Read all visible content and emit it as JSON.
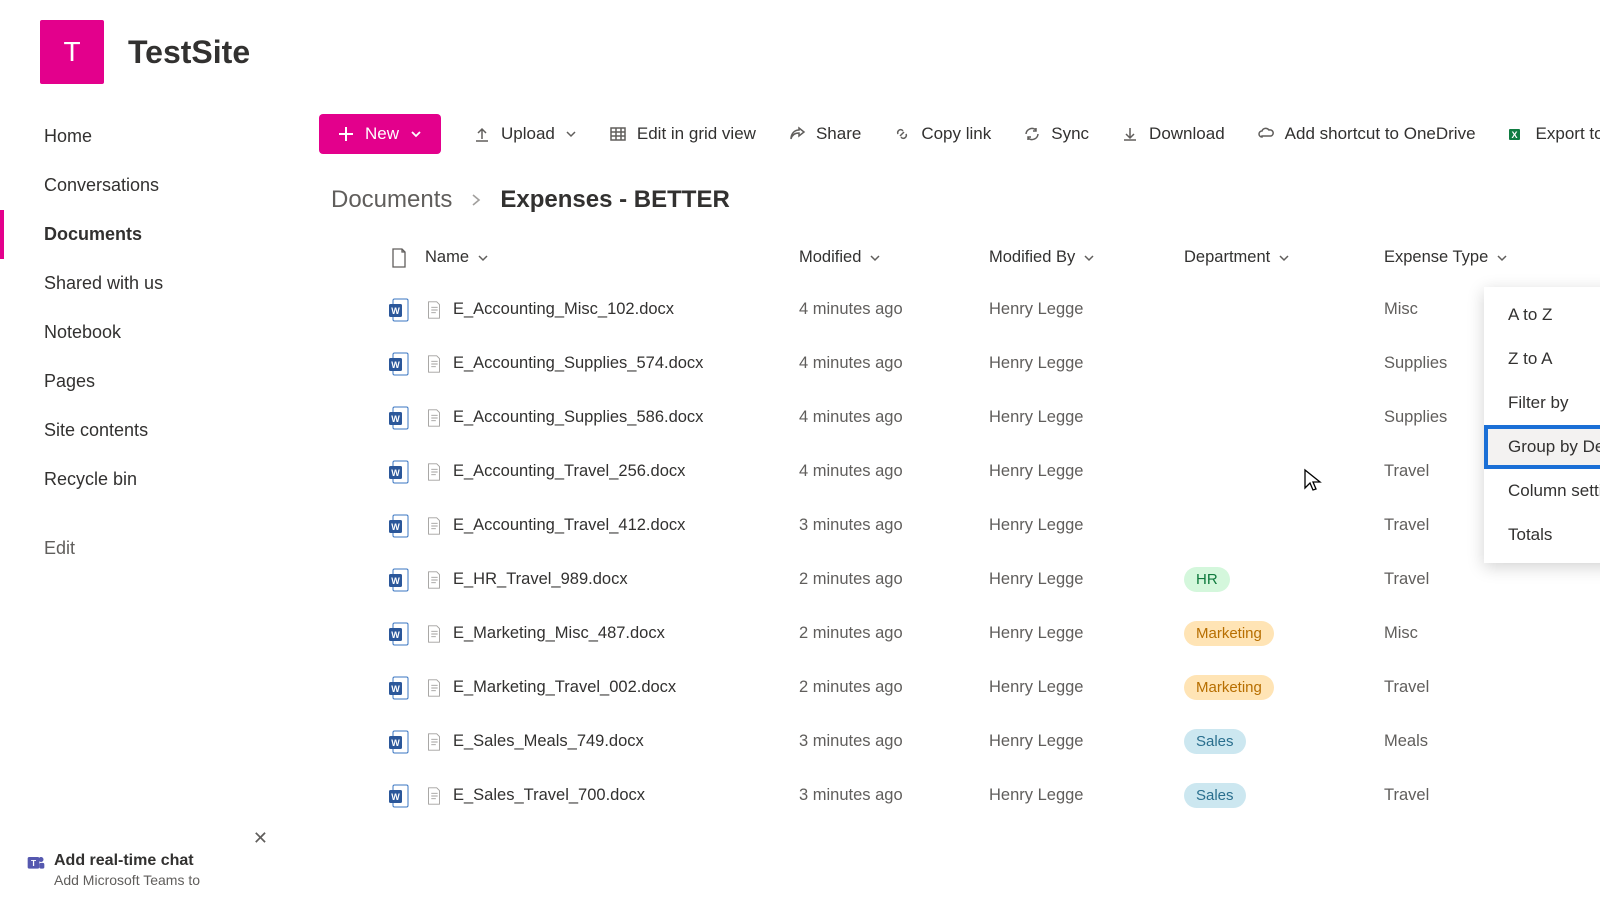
{
  "site": {
    "logo_letter": "T",
    "title": "TestSite"
  },
  "nav": {
    "items": [
      {
        "label": "Home",
        "active": false
      },
      {
        "label": "Conversations",
        "active": false
      },
      {
        "label": "Documents",
        "active": true
      },
      {
        "label": "Shared with us",
        "active": false
      },
      {
        "label": "Notebook",
        "active": false
      },
      {
        "label": "Pages",
        "active": false
      },
      {
        "label": "Site contents",
        "active": false
      },
      {
        "label": "Recycle bin",
        "active": false
      }
    ],
    "edit": "Edit"
  },
  "chat_promo": {
    "title": "Add real-time chat",
    "subtitle": "Add Microsoft Teams to"
  },
  "toolbar": {
    "new": "New",
    "upload": "Upload",
    "grid": "Edit in grid view",
    "share": "Share",
    "copy": "Copy link",
    "sync": "Sync",
    "download": "Download",
    "shortcut": "Add shortcut to OneDrive",
    "export": "Export to Ex"
  },
  "breadcrumb": {
    "root": "Documents",
    "current": "Expenses - BETTER"
  },
  "columns": {
    "name": "Name",
    "modified": "Modified",
    "modified_by": "Modified By",
    "department": "Department",
    "expense_type": "Expense Type"
  },
  "rows": [
    {
      "name": "E_Accounting_Misc_102.docx",
      "modified": "4 minutes ago",
      "by": "Henry Legge",
      "dept": "",
      "exp": "Misc"
    },
    {
      "name": "E_Accounting_Supplies_574.docx",
      "modified": "4 minutes ago",
      "by": "Henry Legge",
      "dept": "",
      "exp": "Supplies"
    },
    {
      "name": "E_Accounting_Supplies_586.docx",
      "modified": "4 minutes ago",
      "by": "Henry Legge",
      "dept": "",
      "exp": "Supplies"
    },
    {
      "name": "E_Accounting_Travel_256.docx",
      "modified": "4 minutes ago",
      "by": "Henry Legge",
      "dept": "",
      "exp": "Travel"
    },
    {
      "name": "E_Accounting_Travel_412.docx",
      "modified": "3 minutes ago",
      "by": "Henry Legge",
      "dept": "",
      "exp": "Travel"
    },
    {
      "name": "E_HR_Travel_989.docx",
      "modified": "2 minutes ago",
      "by": "Henry Legge",
      "dept": "HR",
      "exp": "Travel"
    },
    {
      "name": "E_Marketing_Misc_487.docx",
      "modified": "2 minutes ago",
      "by": "Henry Legge",
      "dept": "Marketing",
      "exp": "Misc"
    },
    {
      "name": "E_Marketing_Travel_002.docx",
      "modified": "2 minutes ago",
      "by": "Henry Legge",
      "dept": "Marketing",
      "exp": "Travel"
    },
    {
      "name": "E_Sales_Meals_749.docx",
      "modified": "3 minutes ago",
      "by": "Henry Legge",
      "dept": "Sales",
      "exp": "Meals"
    },
    {
      "name": "E_Sales_Travel_700.docx",
      "modified": "3 minutes ago",
      "by": "Henry Legge",
      "dept": "Sales",
      "exp": "Travel"
    }
  ],
  "dropdown": {
    "atoz": "A to Z",
    "ztoa": "Z to A",
    "filter": "Filter by",
    "group": "Group by Department",
    "settings": "Column settings",
    "totals": "Totals"
  },
  "dept_colors": {
    "HR": "tag-hr",
    "Marketing": "tag-marketing",
    "Sales": "tag-sales"
  }
}
